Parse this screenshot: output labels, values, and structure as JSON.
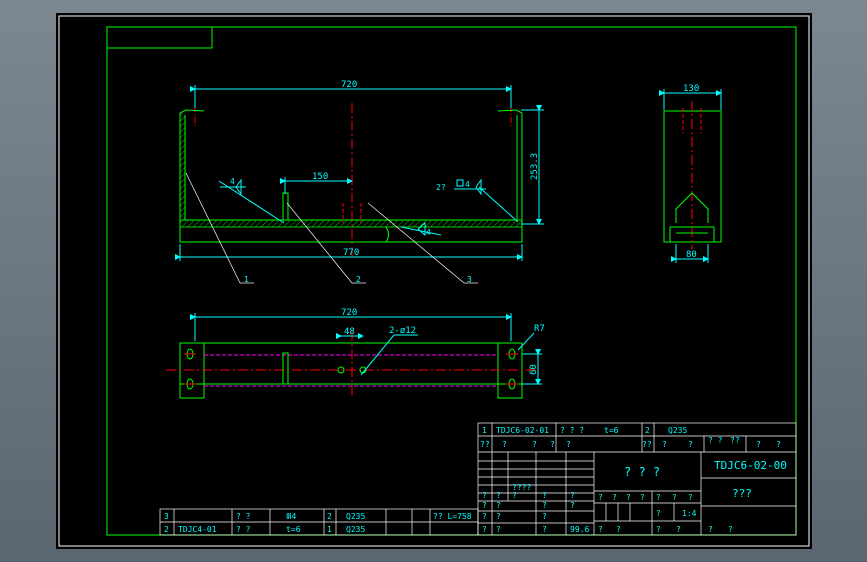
{
  "colors": {
    "background": "#000000",
    "outline": "#00ff00",
    "dimension": "#00ffff",
    "centerline": "#ff0000",
    "hidden": "#ff00ff",
    "text": "#00ffff",
    "frame": "#ffffff"
  },
  "front_view": {
    "dim_top": "720",
    "dim_bottom": "770",
    "dim_height": "253.3",
    "dim_plate": "150",
    "weld_left": "4",
    "weld_right_count": "2?",
    "weld_right": "4",
    "weld_bottom": "4",
    "balloons": [
      "1",
      "2",
      "3"
    ]
  },
  "side_view": {
    "dim_top": "130",
    "dim_bottom": "80"
  },
  "plan_view": {
    "dim_top": "720",
    "dim_spacing": "48",
    "dim_holes": "2-ø12",
    "dim_radius": "R7",
    "dim_width": "60"
  },
  "title_block": {
    "row1": [
      "1",
      "TDJC6-02-01",
      "? ? ?",
      "t=6",
      "2",
      "Q235"
    ],
    "row2": [
      "??",
      "?",
      "?",
      "?",
      "?",
      "??",
      "?",
      "?",
      "? ?",
      "??",
      "?",
      "?"
    ],
    "drawing_number": "TDJC6-02-00",
    "drawing_name": "? ? ?",
    "drawing_subname": "???",
    "scale": "1:4",
    "weight": "99.6",
    "cells": [
      "?",
      "?",
      "?",
      "????",
      "?",
      "?",
      "?",
      "?",
      "?",
      "?",
      "?",
      "?",
      "?",
      "?",
      "?",
      "?",
      "?",
      "?",
      "?",
      "?",
      "?",
      "?",
      "?",
      "?",
      "?",
      "?",
      "?",
      "?",
      "?",
      "?"
    ]
  },
  "parts_list": {
    "rows": [
      {
        "no": "3",
        "code": "",
        "name": "? ?",
        "size": "Ⅲ4",
        "qty": "2",
        "material": "Q235",
        "note": "?? L=758"
      },
      {
        "no": "2",
        "code": "TDJC4-01",
        "name": "? ?",
        "size": "t=6",
        "qty": "1",
        "material": "Q235",
        "note": ""
      }
    ]
  }
}
